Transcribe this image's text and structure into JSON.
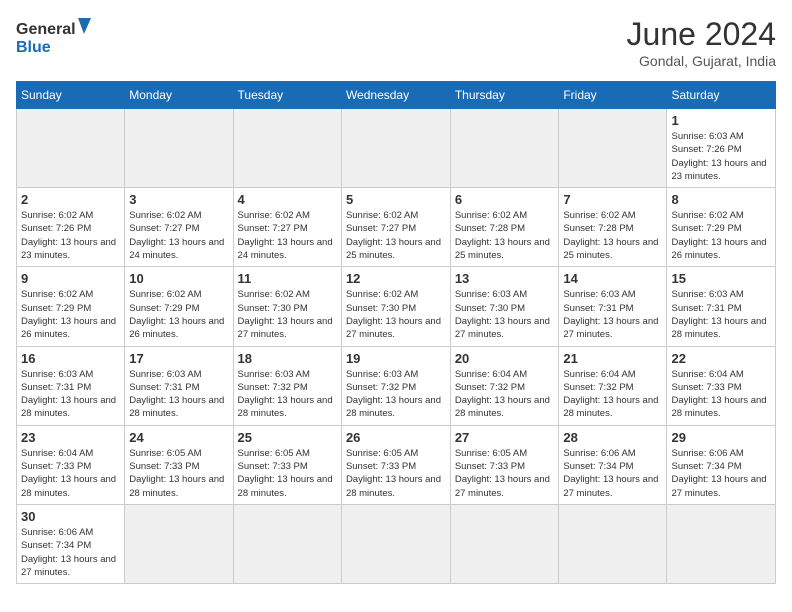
{
  "header": {
    "logo_general": "General",
    "logo_blue": "Blue",
    "month_title": "June 2024",
    "subtitle": "Gondal, Gujarat, India"
  },
  "weekdays": [
    "Sunday",
    "Monday",
    "Tuesday",
    "Wednesday",
    "Thursday",
    "Friday",
    "Saturday"
  ],
  "weeks": [
    [
      {
        "day": "",
        "empty": true
      },
      {
        "day": "",
        "empty": true
      },
      {
        "day": "",
        "empty": true
      },
      {
        "day": "",
        "empty": true
      },
      {
        "day": "",
        "empty": true
      },
      {
        "day": "",
        "empty": true
      },
      {
        "day": "1",
        "sunrise": "6:03 AM",
        "sunset": "7:26 PM",
        "daylight": "13 hours and 23 minutes."
      }
    ],
    [
      {
        "day": "2",
        "sunrise": "6:02 AM",
        "sunset": "7:26 PM",
        "daylight": "13 hours and 23 minutes."
      },
      {
        "day": "3",
        "sunrise": "6:02 AM",
        "sunset": "7:27 PM",
        "daylight": "13 hours and 24 minutes."
      },
      {
        "day": "4",
        "sunrise": "6:02 AM",
        "sunset": "7:27 PM",
        "daylight": "13 hours and 24 minutes."
      },
      {
        "day": "5",
        "sunrise": "6:02 AM",
        "sunset": "7:27 PM",
        "daylight": "13 hours and 25 minutes."
      },
      {
        "day": "6",
        "sunrise": "6:02 AM",
        "sunset": "7:28 PM",
        "daylight": "13 hours and 25 minutes."
      },
      {
        "day": "7",
        "sunrise": "6:02 AM",
        "sunset": "7:28 PM",
        "daylight": "13 hours and 25 minutes."
      },
      {
        "day": "8",
        "sunrise": "6:02 AM",
        "sunset": "7:29 PM",
        "daylight": "13 hours and 26 minutes."
      }
    ],
    [
      {
        "day": "9",
        "sunrise": "6:02 AM",
        "sunset": "7:29 PM",
        "daylight": "13 hours and 26 minutes."
      },
      {
        "day": "10",
        "sunrise": "6:02 AM",
        "sunset": "7:29 PM",
        "daylight": "13 hours and 26 minutes."
      },
      {
        "day": "11",
        "sunrise": "6:02 AM",
        "sunset": "7:30 PM",
        "daylight": "13 hours and 27 minutes."
      },
      {
        "day": "12",
        "sunrise": "6:02 AM",
        "sunset": "7:30 PM",
        "daylight": "13 hours and 27 minutes."
      },
      {
        "day": "13",
        "sunrise": "6:03 AM",
        "sunset": "7:30 PM",
        "daylight": "13 hours and 27 minutes."
      },
      {
        "day": "14",
        "sunrise": "6:03 AM",
        "sunset": "7:31 PM",
        "daylight": "13 hours and 27 minutes."
      },
      {
        "day": "15",
        "sunrise": "6:03 AM",
        "sunset": "7:31 PM",
        "daylight": "13 hours and 28 minutes."
      }
    ],
    [
      {
        "day": "16",
        "sunrise": "6:03 AM",
        "sunset": "7:31 PM",
        "daylight": "13 hours and 28 minutes."
      },
      {
        "day": "17",
        "sunrise": "6:03 AM",
        "sunset": "7:31 PM",
        "daylight": "13 hours and 28 minutes."
      },
      {
        "day": "18",
        "sunrise": "6:03 AM",
        "sunset": "7:32 PM",
        "daylight": "13 hours and 28 minutes."
      },
      {
        "day": "19",
        "sunrise": "6:03 AM",
        "sunset": "7:32 PM",
        "daylight": "13 hours and 28 minutes."
      },
      {
        "day": "20",
        "sunrise": "6:04 AM",
        "sunset": "7:32 PM",
        "daylight": "13 hours and 28 minutes."
      },
      {
        "day": "21",
        "sunrise": "6:04 AM",
        "sunset": "7:32 PM",
        "daylight": "13 hours and 28 minutes."
      },
      {
        "day": "22",
        "sunrise": "6:04 AM",
        "sunset": "7:33 PM",
        "daylight": "13 hours and 28 minutes."
      }
    ],
    [
      {
        "day": "23",
        "sunrise": "6:04 AM",
        "sunset": "7:33 PM",
        "daylight": "13 hours and 28 minutes."
      },
      {
        "day": "24",
        "sunrise": "6:05 AM",
        "sunset": "7:33 PM",
        "daylight": "13 hours and 28 minutes."
      },
      {
        "day": "25",
        "sunrise": "6:05 AM",
        "sunset": "7:33 PM",
        "daylight": "13 hours and 28 minutes."
      },
      {
        "day": "26",
        "sunrise": "6:05 AM",
        "sunset": "7:33 PM",
        "daylight": "13 hours and 28 minutes."
      },
      {
        "day": "27",
        "sunrise": "6:05 AM",
        "sunset": "7:33 PM",
        "daylight": "13 hours and 27 minutes."
      },
      {
        "day": "28",
        "sunrise": "6:06 AM",
        "sunset": "7:34 PM",
        "daylight": "13 hours and 27 minutes."
      },
      {
        "day": "29",
        "sunrise": "6:06 AM",
        "sunset": "7:34 PM",
        "daylight": "13 hours and 27 minutes."
      }
    ],
    [
      {
        "day": "30",
        "sunrise": "6:06 AM",
        "sunset": "7:34 PM",
        "daylight": "13 hours and 27 minutes."
      },
      {
        "day": "",
        "empty": true
      },
      {
        "day": "",
        "empty": true
      },
      {
        "day": "",
        "empty": true
      },
      {
        "day": "",
        "empty": true
      },
      {
        "day": "",
        "empty": true
      },
      {
        "day": "",
        "empty": true
      }
    ]
  ],
  "labels": {
    "sunrise": "Sunrise:",
    "sunset": "Sunset:",
    "daylight": "Daylight:"
  }
}
